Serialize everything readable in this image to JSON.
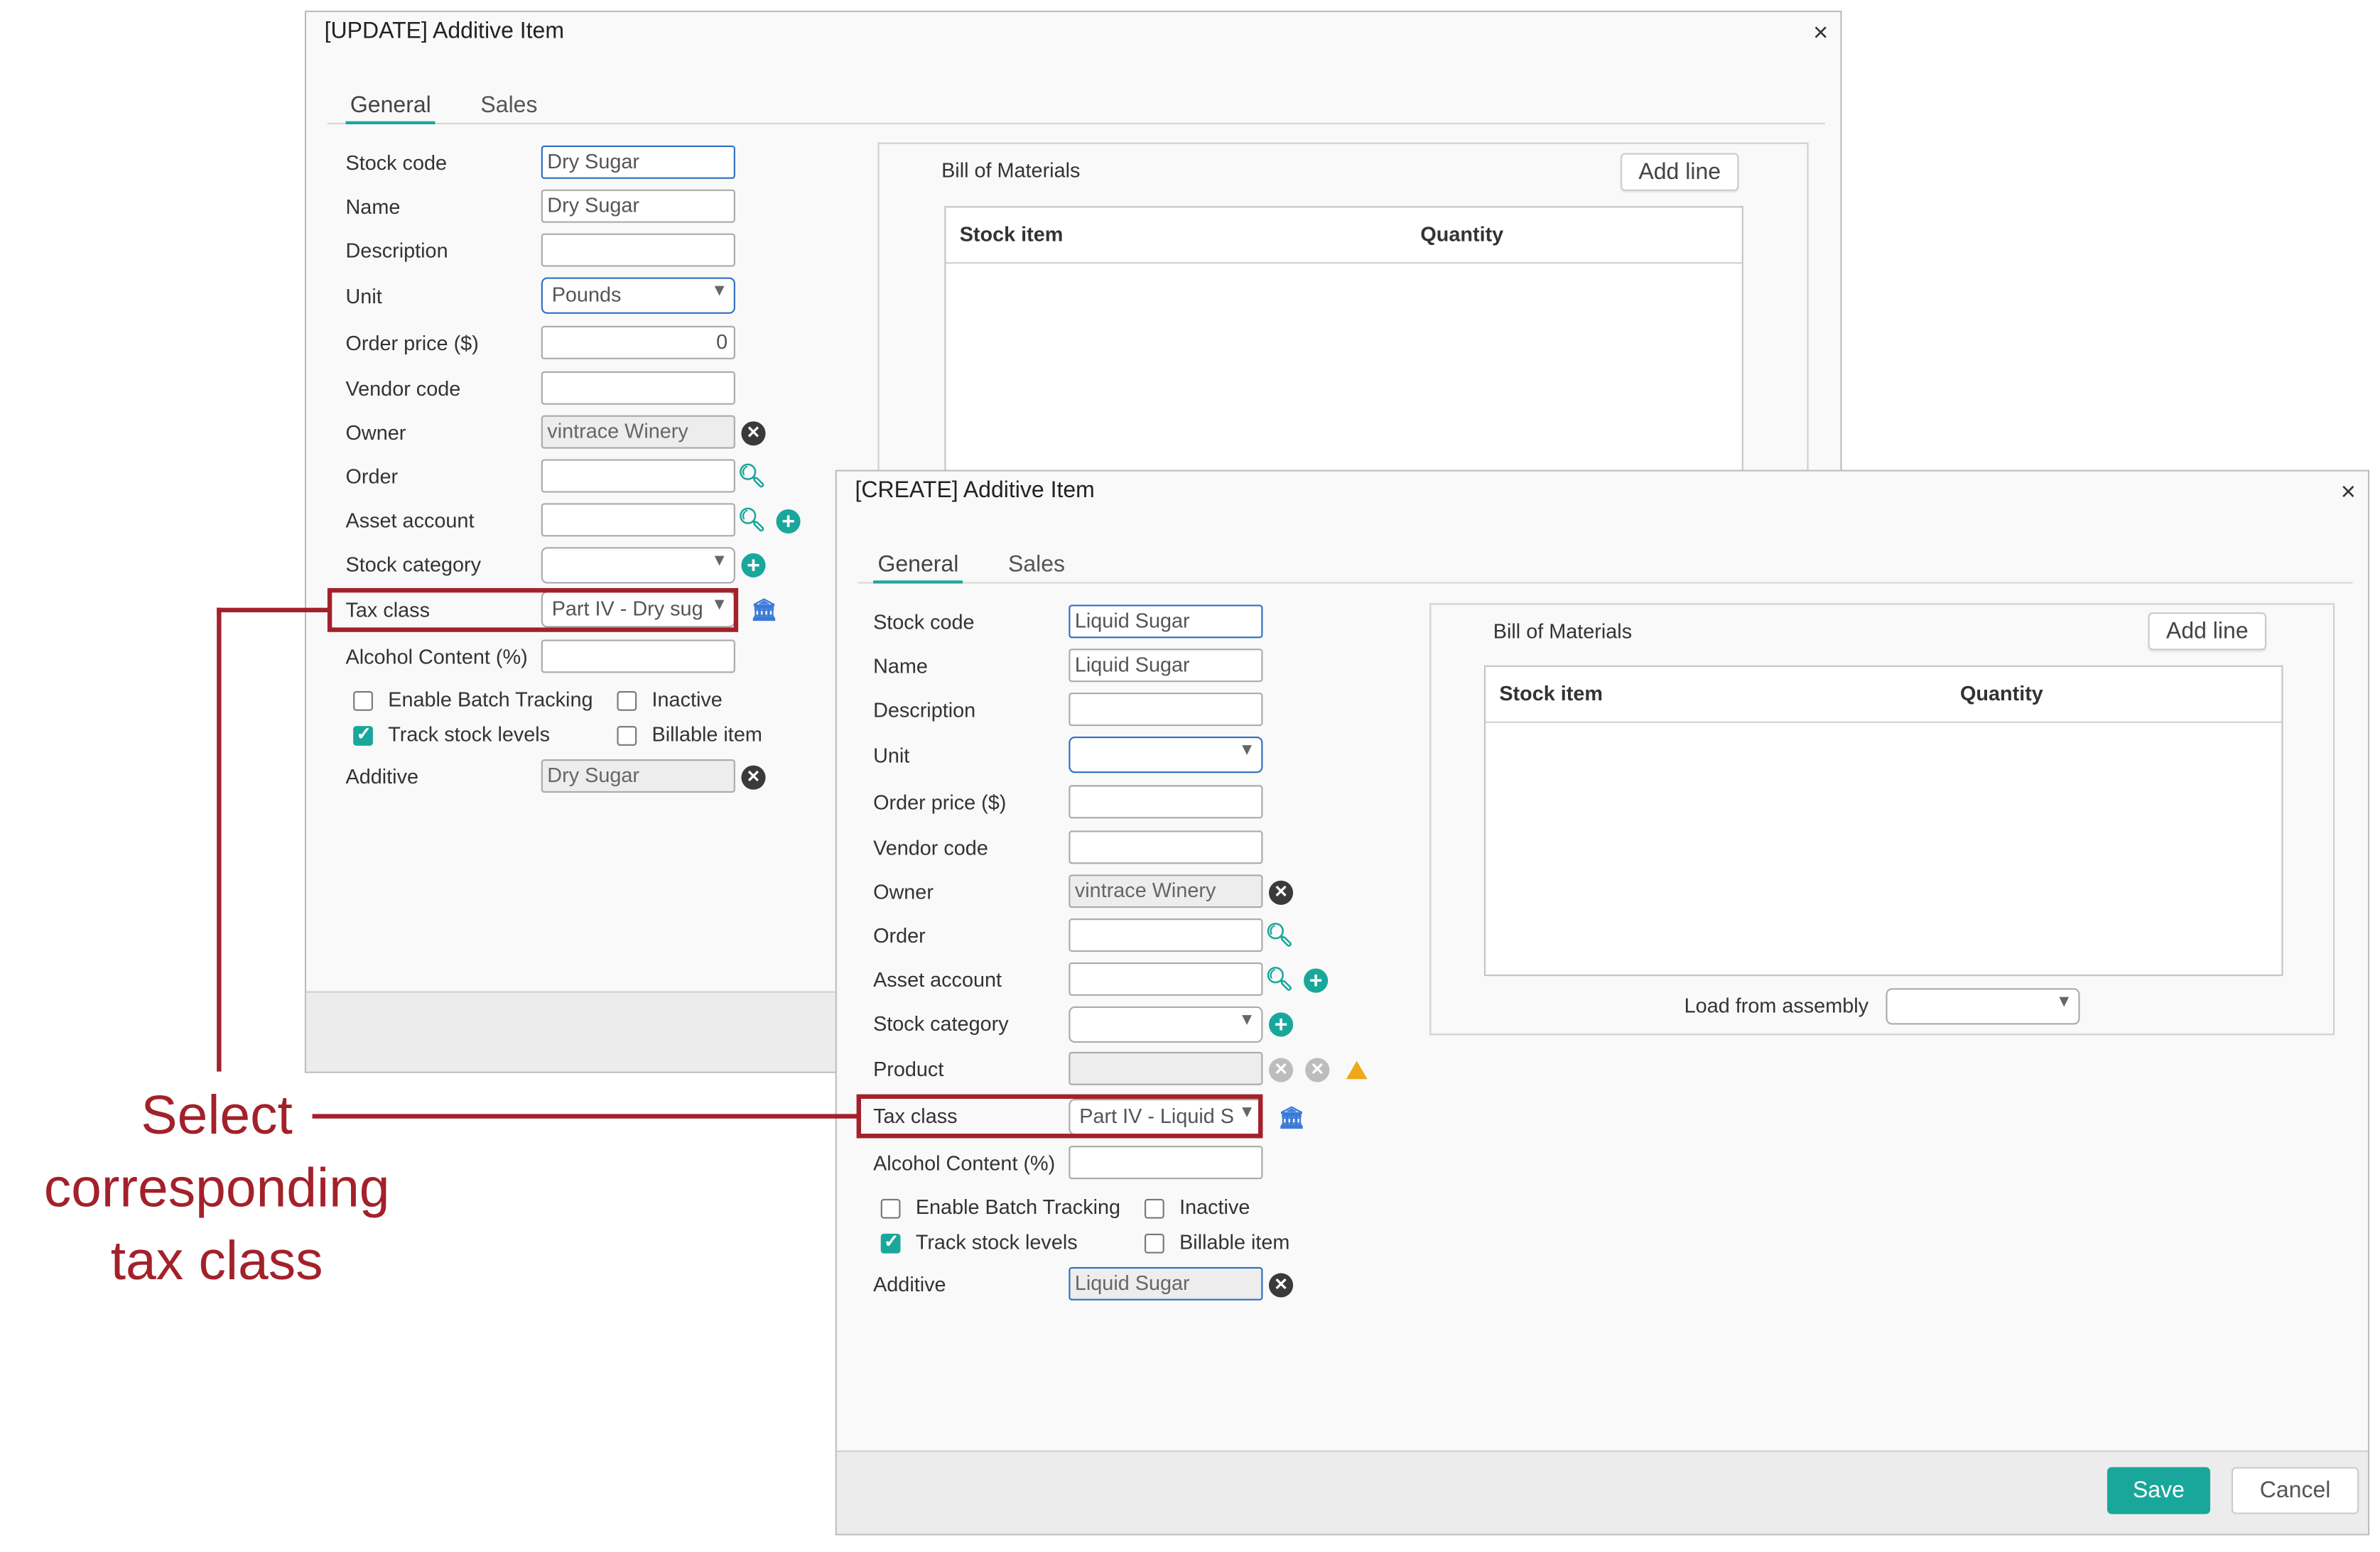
{
  "update_dialog": {
    "title": "[UPDATE] Additive Item",
    "close_glyph": "×",
    "tabs": [
      {
        "label": "General"
      },
      {
        "label": "Sales"
      }
    ],
    "fields": {
      "stock_code": {
        "label": "Stock code",
        "value": "Dry Sugar"
      },
      "name": {
        "label": "Name",
        "value": "Dry Sugar"
      },
      "description": {
        "label": "Description",
        "value": ""
      },
      "unit": {
        "label": "Unit",
        "value": "Pounds"
      },
      "order_price": {
        "label": "Order price ($)",
        "value": "0"
      },
      "vendor_code": {
        "label": "Vendor code",
        "value": ""
      },
      "owner": {
        "label": "Owner",
        "value": "vintrace Winery"
      },
      "order": {
        "label": "Order",
        "value": ""
      },
      "asset_account": {
        "label": "Asset account",
        "value": ""
      },
      "stock_category": {
        "label": "Stock category",
        "value": ""
      },
      "tax_class": {
        "label": "Tax class",
        "value": "Part IV - Dry sug"
      },
      "alcohol_content": {
        "label": "Alcohol Content (%)",
        "value": ""
      },
      "additive": {
        "label": "Additive",
        "value": "Dry Sugar"
      }
    },
    "checkboxes": {
      "enable_batch_tracking": {
        "label": "Enable Batch Tracking",
        "checked": false
      },
      "inactive": {
        "label": "Inactive",
        "checked": false
      },
      "track_stock_levels": {
        "label": "Track stock levels",
        "checked": true
      },
      "billable_item": {
        "label": "Billable item",
        "checked": false
      }
    },
    "bom": {
      "title": "Bill of Materials",
      "add_line": "Add line",
      "columns": [
        "Stock item",
        "Quantity"
      ],
      "rows": []
    }
  },
  "create_dialog": {
    "title": "[CREATE] Additive Item",
    "close_glyph": "×",
    "tabs": [
      {
        "label": "General"
      },
      {
        "label": "Sales"
      }
    ],
    "fields": {
      "stock_code": {
        "label": "Stock code",
        "value": "Liquid Sugar"
      },
      "name": {
        "label": "Name",
        "value": "Liquid Sugar"
      },
      "description": {
        "label": "Description",
        "value": ""
      },
      "unit": {
        "label": "Unit",
        "value": ""
      },
      "order_price": {
        "label": "Order price ($)",
        "value": ""
      },
      "vendor_code": {
        "label": "Vendor code",
        "value": ""
      },
      "owner": {
        "label": "Owner",
        "value": "vintrace Winery"
      },
      "order": {
        "label": "Order",
        "value": ""
      },
      "asset_account": {
        "label": "Asset account",
        "value": ""
      },
      "stock_category": {
        "label": "Stock category",
        "value": ""
      },
      "product": {
        "label": "Product",
        "value": ""
      },
      "tax_class": {
        "label": "Tax class",
        "value": "Part IV - Liquid S"
      },
      "alcohol_content": {
        "label": "Alcohol Content (%)",
        "value": ""
      },
      "additive": {
        "label": "Additive",
        "value": "Liquid Sugar"
      }
    },
    "checkboxes": {
      "enable_batch_tracking": {
        "label": "Enable Batch Tracking",
        "checked": false
      },
      "inactive": {
        "label": "Inactive",
        "checked": false
      },
      "track_stock_levels": {
        "label": "Track stock levels",
        "checked": true
      },
      "billable_item": {
        "label": "Billable item",
        "checked": false
      }
    },
    "bom": {
      "title": "Bill of Materials",
      "add_line": "Add line",
      "columns": [
        "Stock item",
        "Quantity"
      ],
      "rows": [],
      "load_from_assembly": {
        "label": "Load from assembly",
        "value": ""
      }
    },
    "footer": {
      "save": "Save",
      "cancel": "Cancel"
    }
  },
  "annotation": {
    "lines": [
      "Select",
      "corresponding",
      "tax class"
    ],
    "color": "#a3212a"
  },
  "icons": {
    "clear": "x-circle-icon",
    "search": "magnifier-icon",
    "add": "plus-circle-icon",
    "tax": "bank-icon",
    "warning": "warning-triangle-icon",
    "dropdown": "chevron-down-icon"
  },
  "colors": {
    "accent": "#1aa79b",
    "focus_border": "#2d6fc0",
    "annotation": "#a3212a"
  }
}
